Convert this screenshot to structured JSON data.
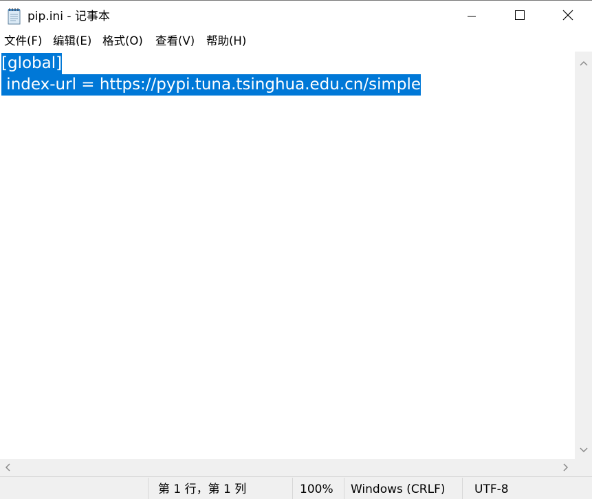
{
  "window": {
    "title": "pip.ini - 记事本",
    "icon": "notepad-icon",
    "controls": [
      "minimize-icon",
      "maximize-icon",
      "close-icon"
    ]
  },
  "menu": {
    "file": "文件(F)",
    "edit": "编辑(E)",
    "format": "格式(O)",
    "view": "查看(V)",
    "help": "帮助(H)"
  },
  "editor": {
    "lines": [
      "[global]",
      " index-url = https://pypi.tuna.tsinghua.edu.cn/simple"
    ],
    "selection_color": "#0078d7"
  },
  "status": {
    "position": "第 1 行，第 1 列",
    "zoom": "100%",
    "line_ending": "Windows (CRLF)",
    "encoding": "UTF-8"
  }
}
